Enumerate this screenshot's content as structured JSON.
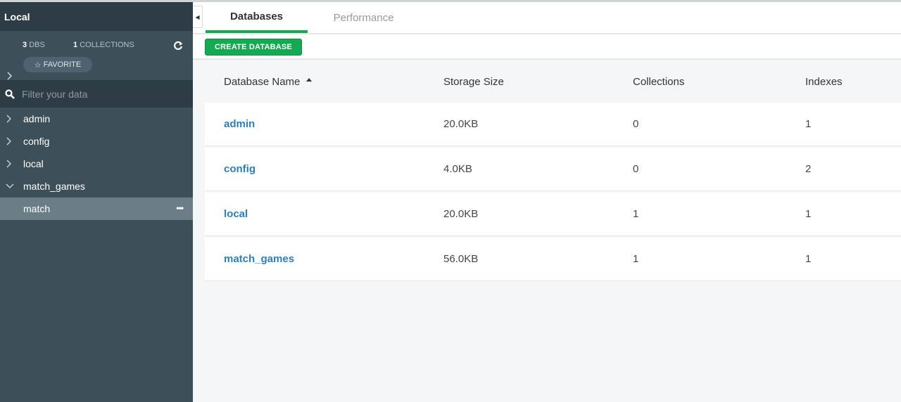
{
  "sidebar": {
    "title": "Local",
    "stats": {
      "dbs_count": "3",
      "dbs_label": "DBS",
      "collections_count": "1",
      "collections_label": "COLLECTIONS"
    },
    "favorite_label": "FAVORITE",
    "filter_placeholder": "Filter your data",
    "databases": [
      {
        "name": "admin",
        "expanded": false
      },
      {
        "name": "config",
        "expanded": false
      },
      {
        "name": "local",
        "expanded": false
      },
      {
        "name": "match_games",
        "expanded": true
      }
    ],
    "collections": [
      {
        "name": "match"
      }
    ]
  },
  "tabs": [
    {
      "label": "Databases",
      "active": true
    },
    {
      "label": "Performance",
      "active": false
    }
  ],
  "toolbar": {
    "create_label": "CREATE DATABASE"
  },
  "table": {
    "headers": [
      "Database Name",
      "Storage Size",
      "Collections",
      "Indexes"
    ],
    "rows": [
      [
        "admin",
        "20.0KB",
        "0",
        "1"
      ],
      [
        "config",
        "4.0KB",
        "0",
        "2"
      ],
      [
        "local",
        "20.0KB",
        "1",
        "1"
      ],
      [
        "match_games",
        "56.0KB",
        "1",
        "1"
      ]
    ]
  },
  "colors": {
    "accent_green": "#13aa52",
    "sidebar_bg": "#3d4f58",
    "link_blue": "#2d7fbb"
  }
}
